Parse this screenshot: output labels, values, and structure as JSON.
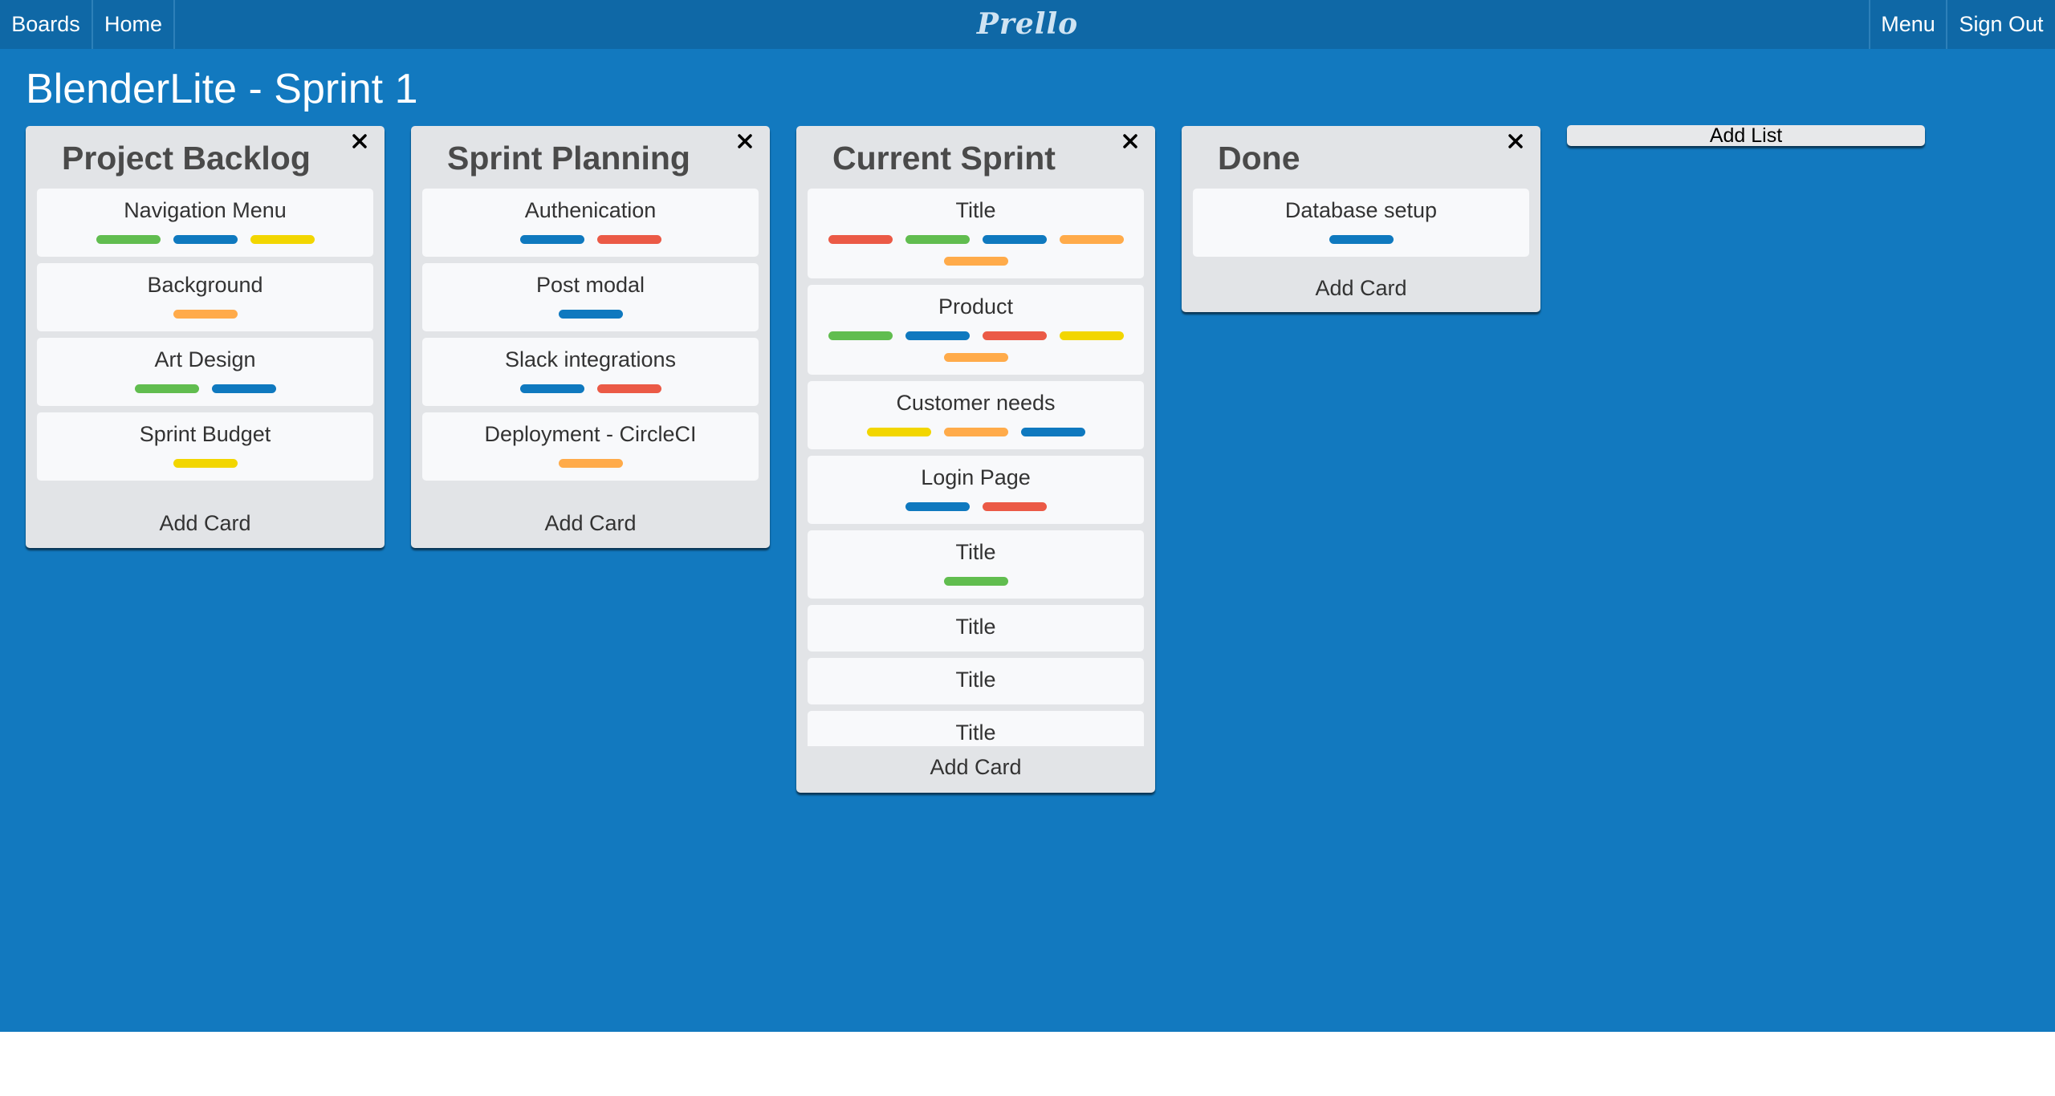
{
  "nav": {
    "boards": "Boards",
    "home": "Home",
    "logo": "Prello",
    "menu": "Menu",
    "sign_out": "Sign Out"
  },
  "board": {
    "title": "BlenderLite - Sprint 1"
  },
  "colors": {
    "green": "#61bd4f",
    "blue": "#0f79bf",
    "yellow": "#f2d600",
    "orange": "#ffab4a",
    "red": "#eb5a46"
  },
  "lists": [
    {
      "title": "Project Backlog",
      "add_card": "Add Card",
      "cards": [
        {
          "title": "Navigation Menu",
          "labels": [
            "green",
            "blue",
            "yellow"
          ]
        },
        {
          "title": "Background",
          "labels": [
            "orange"
          ]
        },
        {
          "title": "Art Design",
          "labels": [
            "green",
            "blue"
          ]
        },
        {
          "title": "Sprint Budget",
          "labels": [
            "yellow"
          ]
        }
      ]
    },
    {
      "title": "Sprint Planning",
      "add_card": "Add Card",
      "cards": [
        {
          "title": "Authenication",
          "labels": [
            "blue",
            "red"
          ]
        },
        {
          "title": "Post modal",
          "labels": [
            "blue"
          ]
        },
        {
          "title": "Slack integrations",
          "labels": [
            "blue",
            "red"
          ]
        },
        {
          "title": "Deployment - CircleCI",
          "labels": [
            "orange"
          ]
        }
      ]
    },
    {
      "title": "Current Sprint",
      "add_card": "Add Card",
      "cards": [
        {
          "title": "Title",
          "labels": [
            "red",
            "green",
            "blue",
            "orange",
            "orange"
          ]
        },
        {
          "title": "Product",
          "labels": [
            "green",
            "blue",
            "red",
            "yellow",
            "orange"
          ]
        },
        {
          "title": "Customer needs",
          "labels": [
            "yellow",
            "orange",
            "blue"
          ]
        },
        {
          "title": "Login Page",
          "labels": [
            "blue",
            "red"
          ]
        },
        {
          "title": "Title",
          "labels": [
            "green"
          ]
        },
        {
          "title": "Title",
          "labels": []
        },
        {
          "title": "Title",
          "labels": []
        },
        {
          "title": "Title",
          "labels": []
        }
      ]
    },
    {
      "title": "Done",
      "add_card": "Add Card",
      "cards": [
        {
          "title": "Database setup",
          "labels": [
            "blue"
          ]
        }
      ]
    }
  ],
  "add_list": "Add List"
}
